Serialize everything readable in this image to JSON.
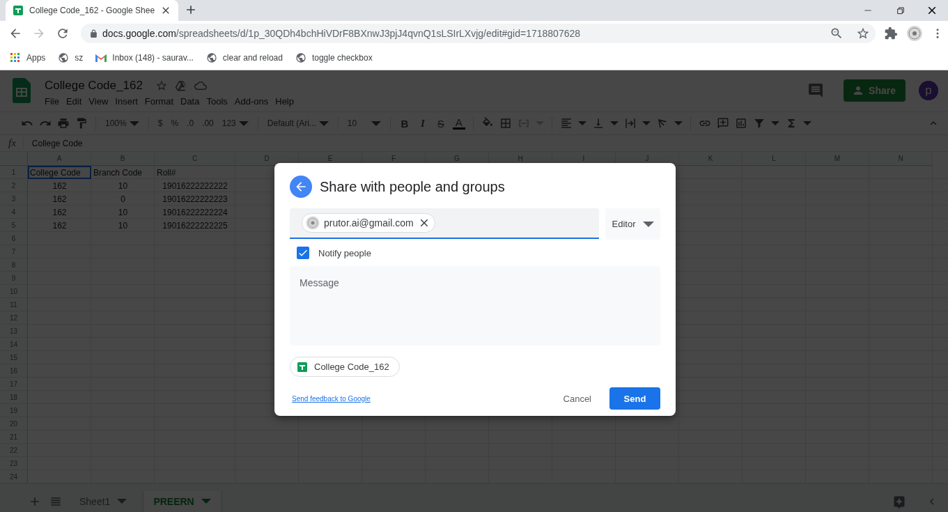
{
  "browser": {
    "tab": {
      "title": "College Code_162 - Google Shee"
    },
    "nav": [
      {
        "kind": "back",
        "disabled": false
      },
      {
        "kind": "forward",
        "disabled": true
      },
      {
        "kind": "reload",
        "disabled": false
      }
    ],
    "url": {
      "domain": "docs.google.com",
      "path": "/spreadsheets/d/1p_30QDh4bchHiVDrF8BXnwJ3pjJ4qvnQ1sLSIrLXvjg/edit#gid=1718807628"
    },
    "bookmarks": [
      {
        "kind": "apps",
        "label": "Apps"
      },
      {
        "kind": "globe",
        "label": "sz"
      },
      {
        "kind": "gmail",
        "label": "Inbox (148) - saurav..."
      },
      {
        "kind": "globe",
        "label": "clear and reload"
      },
      {
        "kind": "globe",
        "label": "toggle checkbox"
      }
    ]
  },
  "app": {
    "title": "College Code_162",
    "menus": [
      "File",
      "Edit",
      "View",
      "Insert",
      "Format",
      "Data",
      "Tools",
      "Add-ons",
      "Help"
    ],
    "share": "Share",
    "avatar": "p",
    "toolbar": {
      "zoom": "100%",
      "currency": "$",
      "percent": "%",
      "decimals_less": ".0",
      "decimals_more": ".00",
      "formats": "123",
      "font": "Default (Ari...",
      "font_size": "10",
      "bold": "B",
      "italic": "I",
      "strikethrough": "S",
      "text_color": "A"
    },
    "formula_bar": {
      "label": "fx",
      "value": "College Code"
    },
    "grid": {
      "columns": [
        "A",
        "B",
        "C",
        "D",
        "E",
        "F",
        "G",
        "H",
        "I",
        "J",
        "K",
        "L",
        "M",
        "N"
      ],
      "rows": [
        {
          "number": "1",
          "kind": "text",
          "cells": [
            {
              "text": "College Code",
              "selected": true
            },
            {
              "text": "Branch Code",
              "selected": false
            },
            {
              "text": "Roll#",
              "selected": false
            }
          ]
        },
        {
          "number": "2",
          "kind": "number",
          "cells": [
            {
              "text": "162",
              "selected": false
            },
            {
              "text": "10",
              "selected": false
            },
            {
              "text": "19016222222222",
              "selected": false
            }
          ]
        },
        {
          "number": "3",
          "kind": "number",
          "cells": [
            {
              "text": "162",
              "selected": false
            },
            {
              "text": "0",
              "selected": false
            },
            {
              "text": "19016222222223",
              "selected": false
            }
          ]
        },
        {
          "number": "4",
          "kind": "number",
          "cells": [
            {
              "text": "162",
              "selected": false
            },
            {
              "text": "10",
              "selected": false
            },
            {
              "text": "19016222222224",
              "selected": false
            }
          ]
        },
        {
          "number": "5",
          "kind": "number",
          "cells": [
            {
              "text": "162",
              "selected": false
            },
            {
              "text": "10",
              "selected": false
            },
            {
              "text": "19016222222225",
              "selected": false
            }
          ]
        },
        {
          "number": "6"
        },
        {
          "number": "7"
        },
        {
          "number": "8"
        },
        {
          "number": "9"
        },
        {
          "number": "10"
        },
        {
          "number": "11"
        },
        {
          "number": "12"
        },
        {
          "number": "13"
        },
        {
          "number": "14"
        },
        {
          "number": "15"
        },
        {
          "number": "16"
        },
        {
          "number": "17"
        },
        {
          "number": "18"
        },
        {
          "number": "19"
        },
        {
          "number": "20"
        },
        {
          "number": "21"
        },
        {
          "number": "22"
        },
        {
          "number": "23"
        },
        {
          "number": "24"
        }
      ]
    },
    "sheet_tabs": [
      {
        "label": "Sheet1",
        "selected": false
      },
      {
        "label": "PREERN",
        "selected": true
      }
    ]
  },
  "dialog": {
    "title": "Share with people and groups",
    "recipients": [
      {
        "email": "prutor.ai@gmail.com"
      }
    ],
    "role": "Editor",
    "notify": {
      "label": "Notify people",
      "checked": true
    },
    "message": {
      "placeholder": "Message"
    },
    "file": {
      "name": "College Code_162"
    },
    "feedback_link": "Send feedback to Google",
    "buttons": [
      {
        "label": "Cancel",
        "kind": "text"
      },
      {
        "label": "Send",
        "kind": "primary"
      }
    ]
  }
}
